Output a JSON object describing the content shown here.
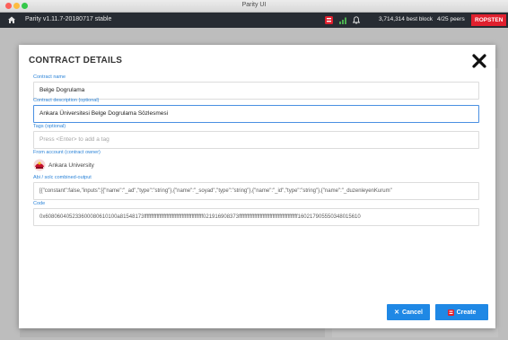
{
  "window": {
    "title": "Parity UI"
  },
  "header": {
    "version": "Parity v1.11.7-20180717 stable",
    "best_block": "3,714,314 best block",
    "peers": "4/25 peers",
    "network": "ROPSTEN",
    "icons": [
      "home-icon",
      "parity-signer-icon",
      "signal-icon",
      "bell-icon"
    ]
  },
  "modal": {
    "title": "CONTRACT DETAILS",
    "fields": {
      "contract_name": {
        "label": "Contract name",
        "value": "Belge Dogrulama"
      },
      "description": {
        "label": "Contract description (optional)",
        "value": "Ankara Üniversitesi Belge Dogrulama Sözlesmesi"
      },
      "tags": {
        "label": "Tags (optional)",
        "placeholder": "Press <Enter> to add a tag"
      },
      "from_account": {
        "label": "From account (contract owner)",
        "value": "Ankara University"
      },
      "abi": {
        "label": "Abi / solc combined-output",
        "value": "[{\"constant\":false,\"inputs\":[{\"name\":\"_ad\",\"type\":\"string\"},{\"name\":\"_soyad\",\"type\":\"string\"},{\"name\":\"_id\",\"type\":\"string\"},{\"name\":\"_duzenleyenKurum\""
      },
      "code": {
        "label": "Code",
        "value": "0x608060405233600080610100a81548173ffffffffffffffffffffffffffffffffffffffffff021916908373ffffffffffffffffffffffffffffffffffffffffff160217905550348015610"
      }
    },
    "buttons": {
      "cancel": "Cancel",
      "create": "Create"
    }
  },
  "colors": {
    "accent": "#1f88e5",
    "header_bg": "#272c33",
    "network_badge": "#e0202e",
    "label_blue": "#2c84d8"
  }
}
